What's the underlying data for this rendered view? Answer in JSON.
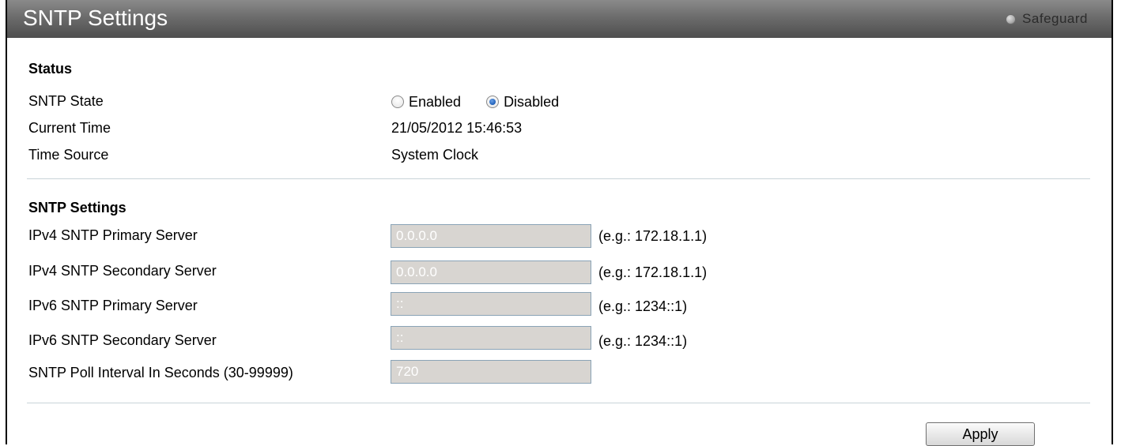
{
  "header": {
    "title": "SNTP Settings",
    "safeguard_label": "Safeguard"
  },
  "status": {
    "heading": "Status",
    "sntp_state_label": "SNTP State",
    "enabled_label": "Enabled",
    "disabled_label": "Disabled",
    "selected": "Disabled",
    "current_time_label": "Current Time",
    "current_time_value": "21/05/2012 15:46:53",
    "time_source_label": "Time Source",
    "time_source_value": "System Clock"
  },
  "settings": {
    "heading": "SNTP Settings",
    "ipv4_primary_label": "IPv4 SNTP Primary Server",
    "ipv4_primary_value": "0.0.0.0",
    "ipv4_primary_hint": "(e.g.: 172.18.1.1)",
    "ipv4_secondary_label": "IPv4 SNTP Secondary Server",
    "ipv4_secondary_value": "0.0.0.0",
    "ipv4_secondary_hint": "(e.g.: 172.18.1.1)",
    "ipv6_primary_label": "IPv6 SNTP Primary Server",
    "ipv6_primary_value": "::",
    "ipv6_primary_hint": "(e.g.: 1234::1)",
    "ipv6_secondary_label": "IPv6 SNTP Secondary Server",
    "ipv6_secondary_value": "::",
    "ipv6_secondary_hint": "(e.g.: 1234::1)",
    "poll_interval_label": "SNTP Poll Interval In Seconds (30-99999)",
    "poll_interval_value": "720"
  },
  "actions": {
    "apply_label": "Apply"
  },
  "colors": {
    "title_bar": "#6c6c6c",
    "input_disabled_bg": "#d8d5d1",
    "separator": "#c8d3d8",
    "radio_selected": "#1f5fb8"
  },
  "icons": {
    "safeguard": "safeguard-status-icon"
  }
}
